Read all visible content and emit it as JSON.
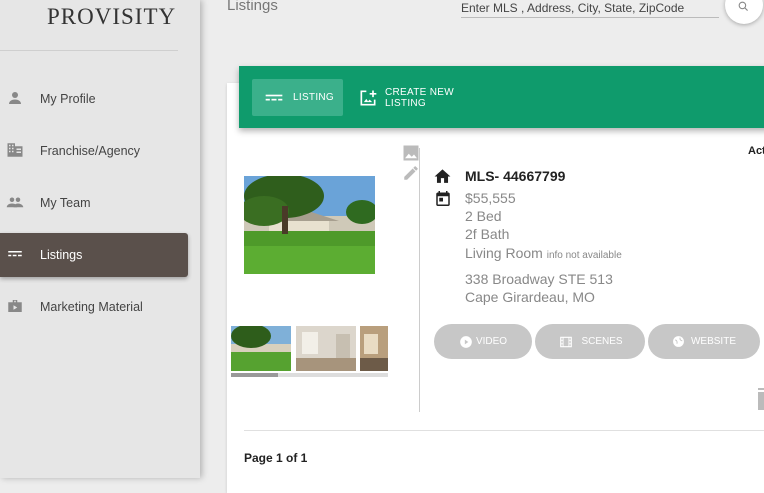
{
  "brand": {
    "logo_text": "PROVISITY"
  },
  "sidebar": {
    "items": [
      {
        "label": "My Profile",
        "icon": "person-icon"
      },
      {
        "label": "Franchise/Agency",
        "icon": "building-icon"
      },
      {
        "label": "My Team",
        "icon": "group-icon"
      },
      {
        "label": "Listings",
        "icon": "listing-icon",
        "active": true
      },
      {
        "label": "Marketing Material",
        "icon": "briefcase-icon"
      }
    ]
  },
  "header": {
    "title": "Listings",
    "search_placeholder": "Enter MLS , Address, City, State, ZipCode"
  },
  "toolbar": {
    "listing_label": "LISTING",
    "create_label": "CREATE NEW LISTING"
  },
  "listing": {
    "status": "Act",
    "mls": "MLS- 44667799",
    "price": "$55,555",
    "beds": "2 Bed",
    "baths": "2f Bath",
    "living_room": "Living Room",
    "living_room_note": "info not available",
    "address_line1": "338 Broadway STE 513",
    "address_line2": "Cape Girardeau, MO",
    "buttons": {
      "video": "VIDEO",
      "scenes": "SCENES",
      "website": "WEBSITE"
    }
  },
  "pagination": {
    "label": "Page 1 of 1"
  },
  "colors": {
    "accent": "#0f9b6c",
    "sidebar_active": "#5a504b",
    "pill": "#c7c7c7"
  }
}
